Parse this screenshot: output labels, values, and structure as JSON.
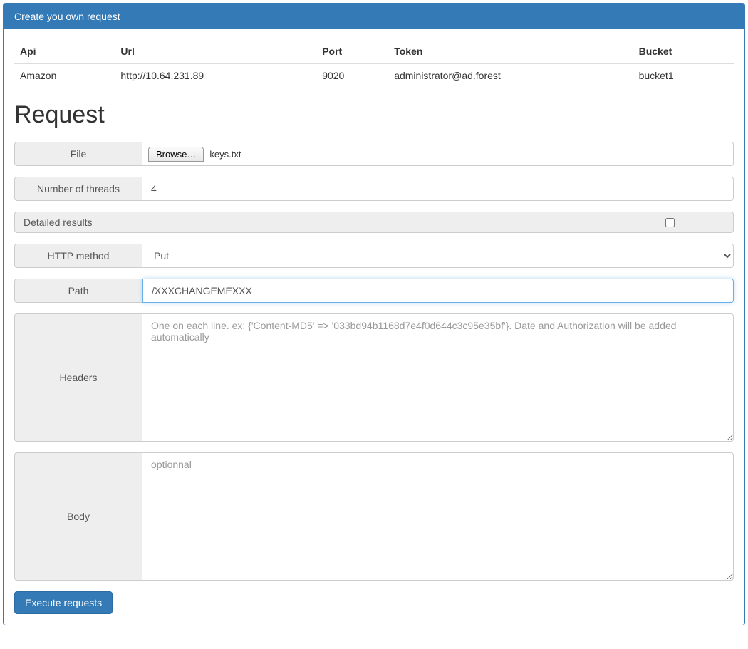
{
  "panel": {
    "title": "Create you own request"
  },
  "info": {
    "headers": {
      "api": "Api",
      "url": "Url",
      "port": "Port",
      "token": "Token",
      "bucket": "Bucket"
    },
    "row": {
      "api": "Amazon",
      "url": "http://10.64.231.89",
      "port": "9020",
      "token": "administrator@ad.forest",
      "bucket": "bucket1"
    }
  },
  "section_title": "Request",
  "form": {
    "file": {
      "label": "File",
      "browse": "Browse…",
      "filename": "keys.txt"
    },
    "threads": {
      "label": "Number of threads",
      "value": "4"
    },
    "detailed": {
      "label": "Detailed results",
      "checked": false
    },
    "method": {
      "label": "HTTP method",
      "value": "Put"
    },
    "path": {
      "label": "Path",
      "value": "/XXXCHANGEMEXXX"
    },
    "headers": {
      "label": "Headers",
      "placeholder": "One on each line. ex: {'Content-MD5' => '033bd94b1168d7e4f0d644c3c95e35bf'}. Date and Authorization will be added automatically"
    },
    "body": {
      "label": "Body",
      "placeholder": "optionnal"
    },
    "submit": "Execute requests"
  }
}
